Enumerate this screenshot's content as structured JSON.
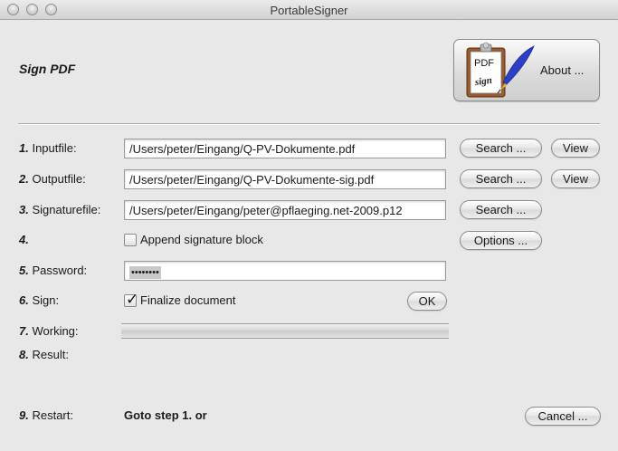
{
  "window": {
    "title": "PortableSigner"
  },
  "header": {
    "heading": "Sign PDF",
    "about_label": "About ...",
    "logo_pdf": "PDF",
    "logo_sign": "sign"
  },
  "steps": {
    "input": {
      "num": "1.",
      "label": "Inputfile:",
      "value": "/Users/peter/Eingang/Q-PV-Dokumente.pdf",
      "search": "Search ...",
      "view": "View"
    },
    "output": {
      "num": "2.",
      "label": "Outputfile:",
      "value": "/Users/peter/Eingang/Q-PV-Dokumente-sig.pdf",
      "search": "Search ...",
      "view": "View"
    },
    "signature": {
      "num": "3.",
      "label": "Signaturefile:",
      "value": "/Users/peter/Eingang/peter@pflaeging.net-2009.p12",
      "search": "Search ..."
    },
    "append": {
      "num": "4.",
      "label": "",
      "checkbox_label": "Append signature block",
      "checked": false,
      "options": "Options ..."
    },
    "password": {
      "num": "5.",
      "label": "Password:",
      "masked": "••••••••"
    },
    "sign": {
      "num": "6.",
      "label": "Sign:",
      "checkbox_label": "Finalize document",
      "checked": true,
      "ok": "OK"
    },
    "working": {
      "num": "7.",
      "label": "Working:",
      "progress": 0
    },
    "result": {
      "num": "8.",
      "label": "Result:"
    },
    "restart": {
      "num": "9.",
      "label": "Restart:",
      "text": "Goto step 1. or",
      "cancel": "Cancel ..."
    }
  }
}
